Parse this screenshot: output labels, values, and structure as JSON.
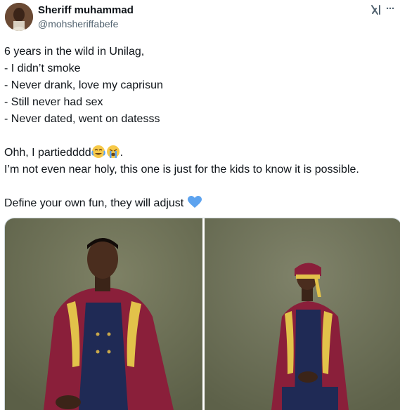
{
  "author": {
    "display_name": "Sheriff muhammad",
    "handle": "@mohsheriffabefe"
  },
  "header_icons": [
    "grok-icon",
    "more-icon"
  ],
  "tweet": {
    "lines": [
      "6 years in the wild in Unilag,",
      "- I didn’t smoke",
      "- Never drank, love my caprisun",
      "- Still never had sex",
      "- Never dated, went on datesss"
    ],
    "party_line": "Ohh, I partiedddd",
    "party_emojis": [
      "face-with-tears-of-joy",
      "loudly-crying-face"
    ],
    "party_end": ".",
    "holy_line": "I’m not even near holy, this one is just for the kids to know it is possible.",
    "fun_line": "Define your own fun, they will adjust",
    "fun_emoji": "blue-heart"
  },
  "media": {
    "count": 2,
    "photos": [
      "graduate-photo-seated",
      "graduate-photo-seated-with-cap"
    ]
  },
  "colors": {
    "text": "#0f1419",
    "secondary": "#536471",
    "heart": "#5da3ef",
    "backdrop": "#6f7358",
    "gown": "#8a1f3a",
    "gown_trim": "#e2c24a"
  }
}
